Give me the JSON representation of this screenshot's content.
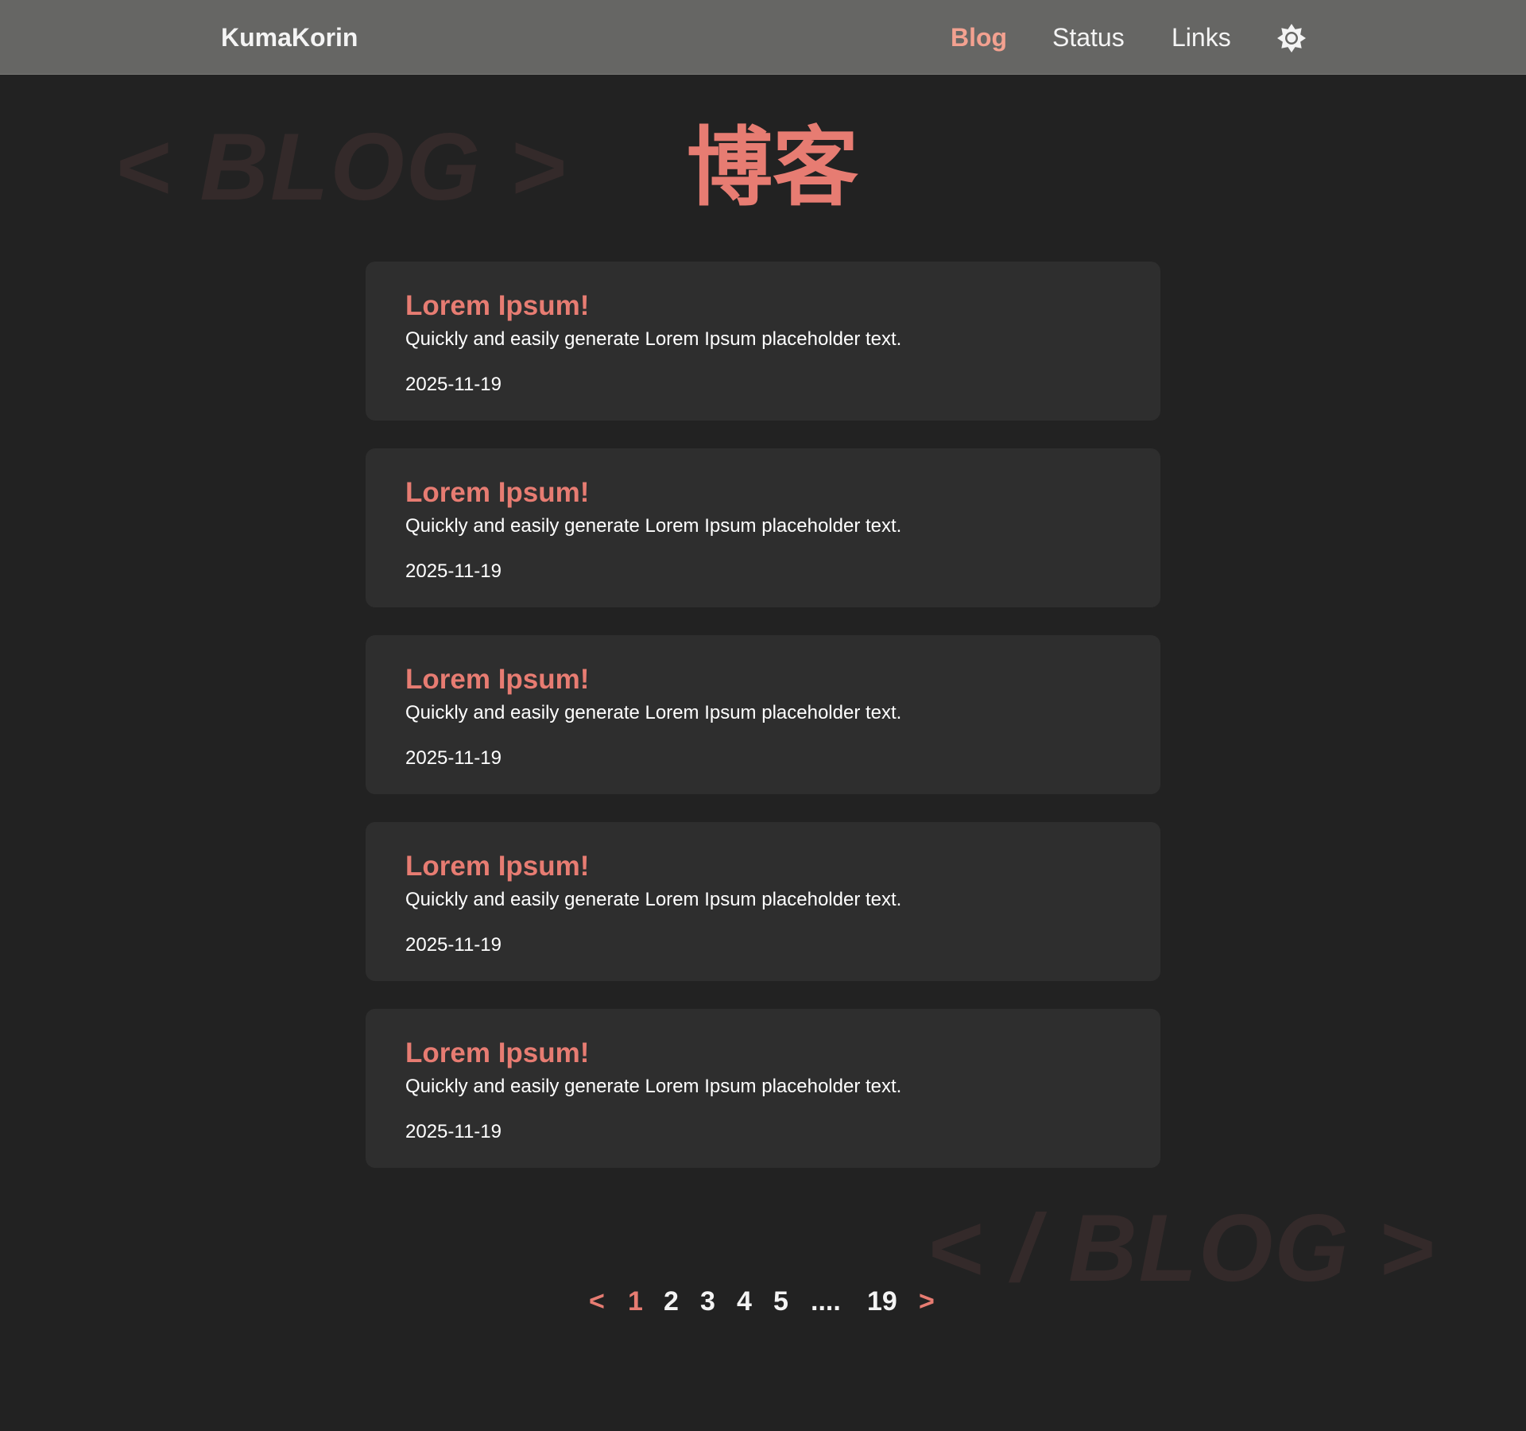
{
  "navbar": {
    "brand": "KumaKorin",
    "links": [
      {
        "label": "Blog",
        "active": true
      },
      {
        "label": "Status",
        "active": false
      },
      {
        "label": "Links",
        "active": false
      }
    ],
    "theme_icon": "sun-icon"
  },
  "hero": {
    "deco_top": "< BLOG >",
    "title": "博客",
    "deco_bottom": "< / BLOG >"
  },
  "posts": [
    {
      "title": "Lorem Ipsum!",
      "description": "Quickly and easily generate Lorem Ipsum placeholder text.",
      "date": "2025-11-19"
    },
    {
      "title": "Lorem Ipsum!",
      "description": "Quickly and easily generate Lorem Ipsum placeholder text.",
      "date": "2025-11-19"
    },
    {
      "title": "Lorem Ipsum!",
      "description": "Quickly and easily generate Lorem Ipsum placeholder text.",
      "date": "2025-11-19"
    },
    {
      "title": "Lorem Ipsum!",
      "description": "Quickly and easily generate Lorem Ipsum placeholder text.",
      "date": "2025-11-19"
    },
    {
      "title": "Lorem Ipsum!",
      "description": "Quickly and easily generate Lorem Ipsum placeholder text.",
      "date": "2025-11-19"
    }
  ],
  "pagination": {
    "prev": "<",
    "pages": [
      "1",
      "2",
      "3",
      "4",
      "5"
    ],
    "current": "1",
    "ellipsis": "....",
    "last": "19",
    "next": ">"
  },
  "colors": {
    "background": "#222222",
    "navbar": "#666664",
    "card": "#2e2e2e",
    "accent": "#e77c72",
    "nav_active": "#f3a190",
    "deco": "#342a2a"
  }
}
